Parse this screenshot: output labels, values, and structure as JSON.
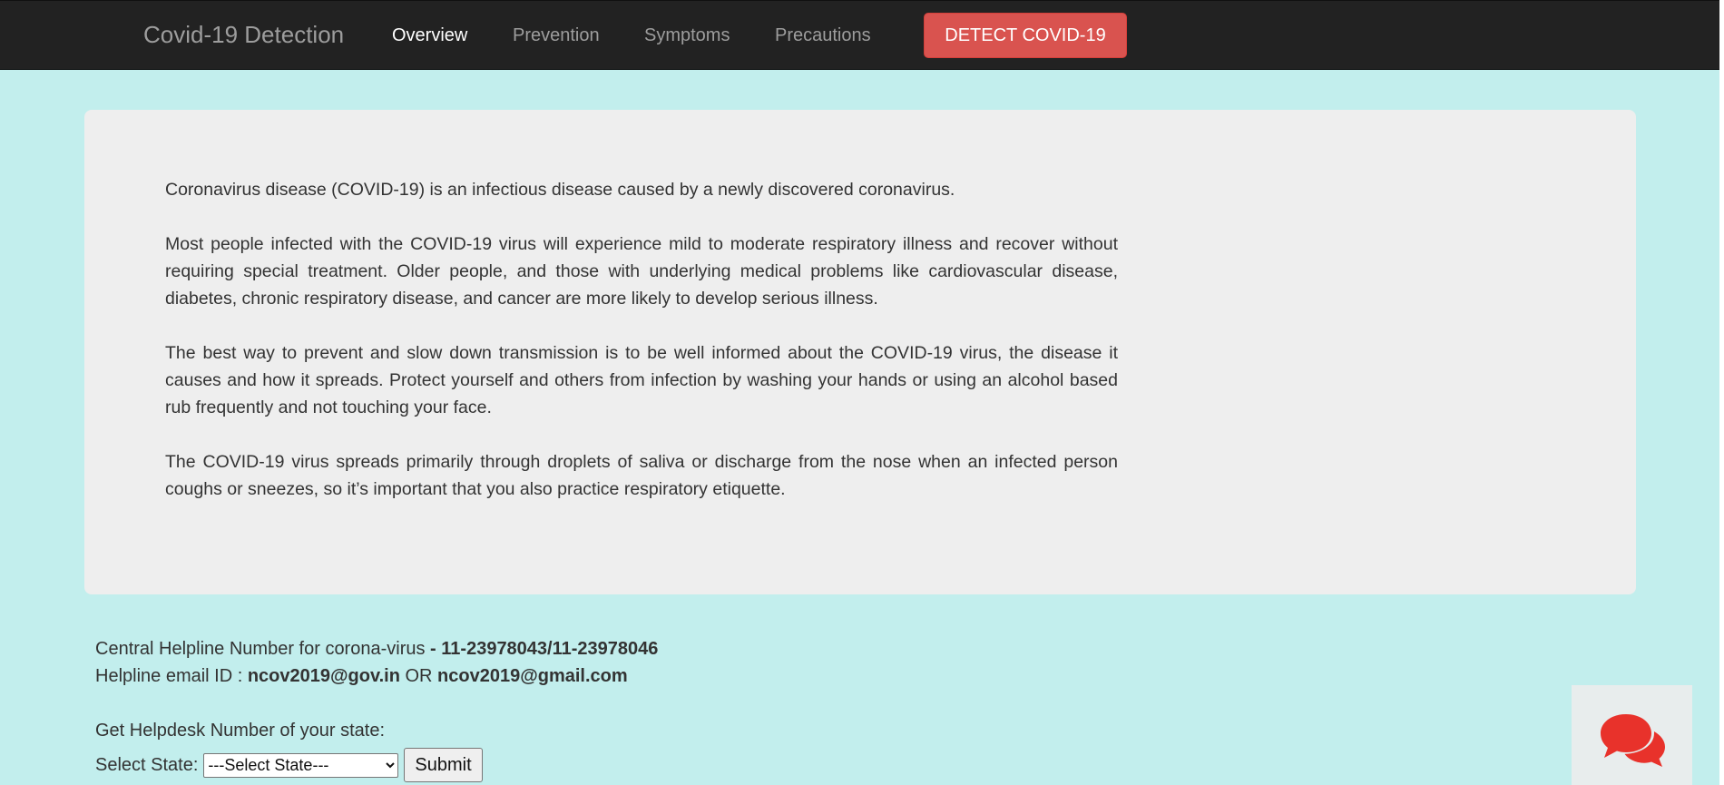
{
  "navbar": {
    "brand": "Covid-19 Detection",
    "links": [
      {
        "label": "Overview",
        "active": true
      },
      {
        "label": "Prevention",
        "active": false
      },
      {
        "label": "Symptoms",
        "active": false
      },
      {
        "label": "Precautions",
        "active": false
      }
    ],
    "detect_button": "DETECT COVID-19"
  },
  "overview": {
    "paragraphs": [
      "Coronavirus disease (COVID-19) is an infectious disease caused by a newly discovered coronavirus.",
      "Most people infected with the COVID-19 virus will experience mild to moderate respiratory illness and recover without requiring special treatment. Older people, and those with underlying medical problems like cardiovascular disease, diabetes, chronic respiratory disease, and cancer are more likely to develop serious illness.",
      "The best way to prevent and slow down transmission is to be well informed about the COVID-19 virus, the disease it causes and how it spreads. Protect yourself and others from infection by washing your hands or using an alcohol based rub frequently and not touching your face.",
      "The COVID-19 virus spreads primarily through droplets of saliva or discharge from the nose when an infected person coughs or sneezes, so it’s important that you also practice respiratory etiquette."
    ]
  },
  "helpline": {
    "phone_label": "Central Helpline Number for corona-virus",
    "phone_separator": " - ",
    "phone_number": "11-23978043/11-23978046",
    "email_label": "Helpline email ID : ",
    "email_primary": "ncov2019@gov.in",
    "email_or": " OR ",
    "email_secondary": "ncov2019@gmail.com"
  },
  "state_form": {
    "heading": "Get Helpdesk Number of your state:",
    "select_label": "Select State:",
    "selected_option": "---Select State---",
    "submit_label": "Submit"
  },
  "icons": {
    "chat": "chat-bubbles-icon"
  },
  "colors": {
    "page_background": "#c2eeed",
    "navbar_background": "#222222",
    "detect_button": "#d9534f",
    "jumbotron_background": "#eeeeee",
    "chat_icon": "#e8322b"
  }
}
